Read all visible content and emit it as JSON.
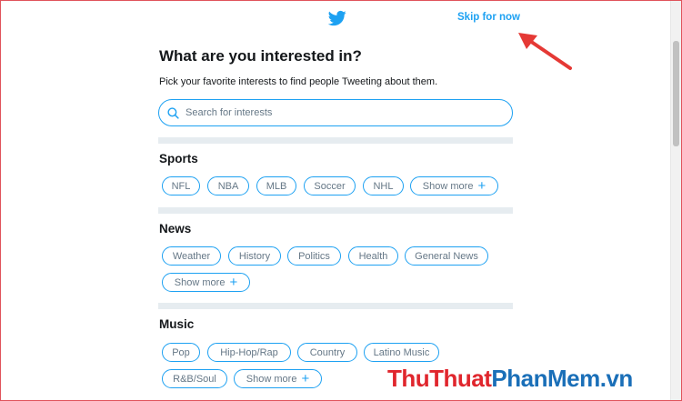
{
  "header": {
    "logo_icon": "twitter-bird-icon",
    "skip_label": "Skip for now",
    "accent": "#1da1f2"
  },
  "main": {
    "title": "What are you interested in?",
    "subtitle": "Pick your favorite interests to find people Tweeting about them.",
    "search": {
      "placeholder": "Search for interests",
      "value": ""
    }
  },
  "sections": [
    {
      "title": "Sports",
      "chips": [
        "NFL",
        "NBA",
        "MLB",
        "Soccer",
        "NHL"
      ],
      "show_more": "Show more"
    },
    {
      "title": "News",
      "chips": [
        "Weather",
        "History",
        "Politics",
        "Health",
        "General News"
      ],
      "show_more": "Show more"
    },
    {
      "title": "Music",
      "chips": [
        "Pop",
        "Hip-Hop/Rap",
        "Country",
        "Latino Music",
        "R&B/Soul"
      ],
      "show_more": "Show more"
    }
  ],
  "watermark": {
    "part1": "ThuThuat",
    "part2": "PhanMem",
    "part3": ".vn",
    "color_red": "#e0262d",
    "color_blue": "#1a6fb8"
  }
}
